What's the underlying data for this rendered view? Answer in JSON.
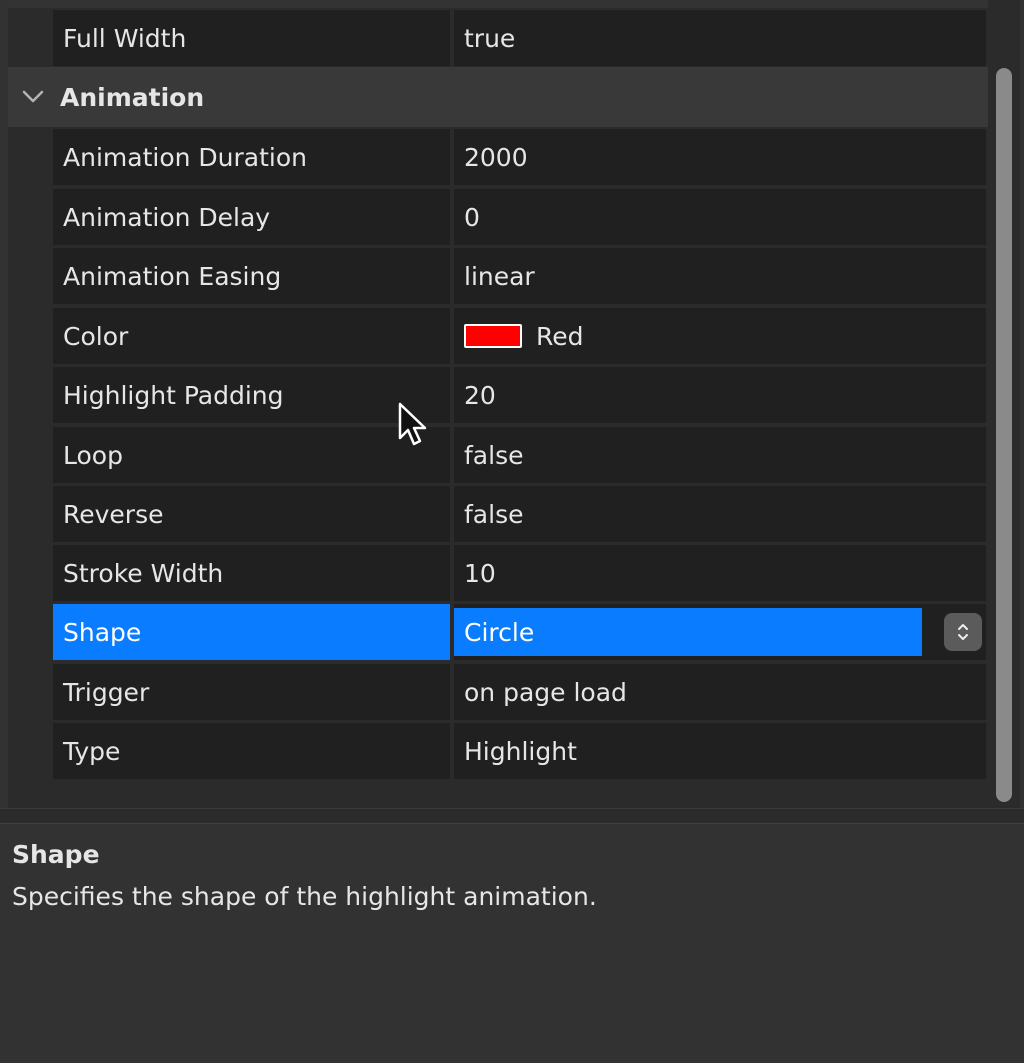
{
  "properties": {
    "top_row": {
      "key": "Full Width",
      "value": "true"
    },
    "group": {
      "title": "Animation"
    },
    "rows": [
      {
        "key": "Animation Duration",
        "value": "2000"
      },
      {
        "key": "Animation Delay",
        "value": "0"
      },
      {
        "key": "Animation Easing",
        "value": "linear"
      },
      {
        "key": "Color",
        "value": "Red"
      },
      {
        "key": "Highlight Padding",
        "value": "20"
      },
      {
        "key": "Loop",
        "value": "false"
      },
      {
        "key": "Reverse",
        "value": "false"
      },
      {
        "key": "Stroke Width",
        "value": "10"
      },
      {
        "key": "Shape",
        "value": "Circle"
      },
      {
        "key": "Trigger",
        "value": "on page load"
      },
      {
        "key": "Type",
        "value": "Highlight"
      }
    ],
    "color_swatch_hex": "#ff0000",
    "selected_key": "Shape"
  },
  "help": {
    "title": "Shape",
    "description": "Specifies the shape of the highlight animation."
  },
  "icons": {
    "group_toggle": "chevron-down-icon",
    "stepper": "up-down-stepper-icon",
    "cursor": "mouse-pointer-icon"
  },
  "colors": {
    "selection": "#0a7cff",
    "background": "#202020"
  }
}
